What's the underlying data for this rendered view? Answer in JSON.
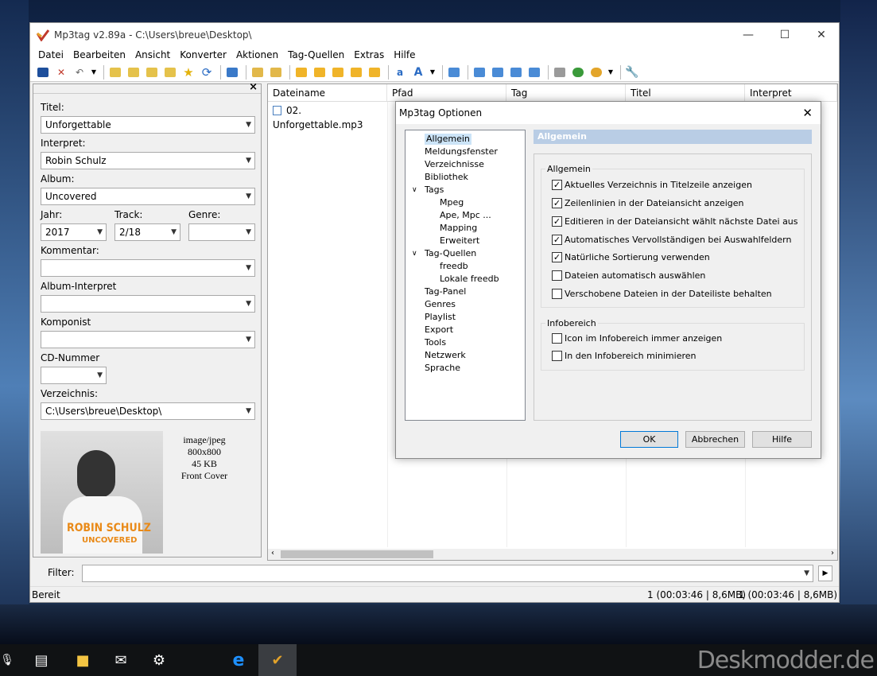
{
  "window": {
    "title": "Mp3tag v2.89a  -  C:\\Users\\breue\\Desktop\\",
    "minimize": "—",
    "maximize": "☐",
    "close": "✕"
  },
  "menu": [
    "Datei",
    "Bearbeiten",
    "Ansicht",
    "Konverter",
    "Aktionen",
    "Tag-Quellen",
    "Extras",
    "Hilfe"
  ],
  "tagpanel": {
    "panel_close": "×",
    "titel_label": "Titel:",
    "titel_value": "Unforgettable",
    "interpret_label": "Interpret:",
    "interpret_value": "Robin Schulz",
    "album_label": "Album:",
    "album_value": "Uncovered",
    "jahr_label": "Jahr:",
    "jahr_value": "2017",
    "track_label": "Track:",
    "track_value": "2/18",
    "genre_label": "Genre:",
    "genre_value": "",
    "kommentar_label": "Kommentar:",
    "kommentar_value": "",
    "albuminterpret_label": "Album-Interpret",
    "albuminterpret_value": "",
    "komponist_label": "Komponist",
    "komponist_value": "",
    "cd_label": "CD-Nummer",
    "cd_value": "",
    "verzeichnis_label": "Verzeichnis:",
    "verzeichnis_value": "C:\\Users\\breue\\Desktop\\",
    "cover_text1": "ROBIN SCHULZ",
    "cover_text2": "UNCOVERED",
    "image_type": "image/jpeg",
    "image_size": "800x800",
    "image_kb": "45 KB",
    "image_kind": "Front Cover"
  },
  "filelist": {
    "columns": [
      "Dateiname",
      "Pfad",
      "Tag",
      "Titel",
      "Interpret"
    ],
    "row_filename": "02. Unforgettable.mp3"
  },
  "filter": {
    "label": "Filter:",
    "value": ""
  },
  "status": {
    "left": "Bereit",
    "sel": "1 (00:03:46 | 8,6MB)",
    "total": "1 (00:03:46 | 8,6MB)"
  },
  "dialog": {
    "title": "Mp3tag Optionen",
    "tree": [
      "Allgemein",
      "Meldungsfenster",
      "Verzeichnisse",
      "Bibliothek",
      "Tags",
      "Mpeg",
      "Ape, Mpc ...",
      "Mapping",
      "Erweitert",
      "Tag-Quellen",
      "freedb",
      "Lokale freedb",
      "Tag-Panel",
      "Genres",
      "Playlist",
      "Export",
      "Tools",
      "Netzwerk",
      "Sprache"
    ],
    "section": "Allgemein",
    "group1": "Allgemein",
    "options1": [
      {
        "label": "Aktuelles Verzeichnis in Titelzeile anzeigen",
        "checked": true
      },
      {
        "label": "Zeilenlinien in der Dateiansicht anzeigen",
        "checked": true
      },
      {
        "label": "Editieren in der Dateiansicht wählt nächste Datei aus",
        "checked": true
      },
      {
        "label": "Automatisches Vervollständigen bei Auswahlfeldern",
        "checked": true
      },
      {
        "label": "Natürliche Sortierung verwenden",
        "checked": true
      },
      {
        "label": "Dateien automatisch auswählen",
        "checked": false
      },
      {
        "label": "Verschobene Dateien in der Dateiliste behalten",
        "checked": false
      }
    ],
    "group2": "Infobereich",
    "options2": [
      {
        "label": "Icon im Infobereich immer anzeigen",
        "checked": false
      },
      {
        "label": "In den Infobereich minimieren",
        "checked": false
      }
    ],
    "ok": "OK",
    "cancel": "Abbrechen",
    "help": "Hilfe"
  },
  "watermark": "Deskmodder.de"
}
